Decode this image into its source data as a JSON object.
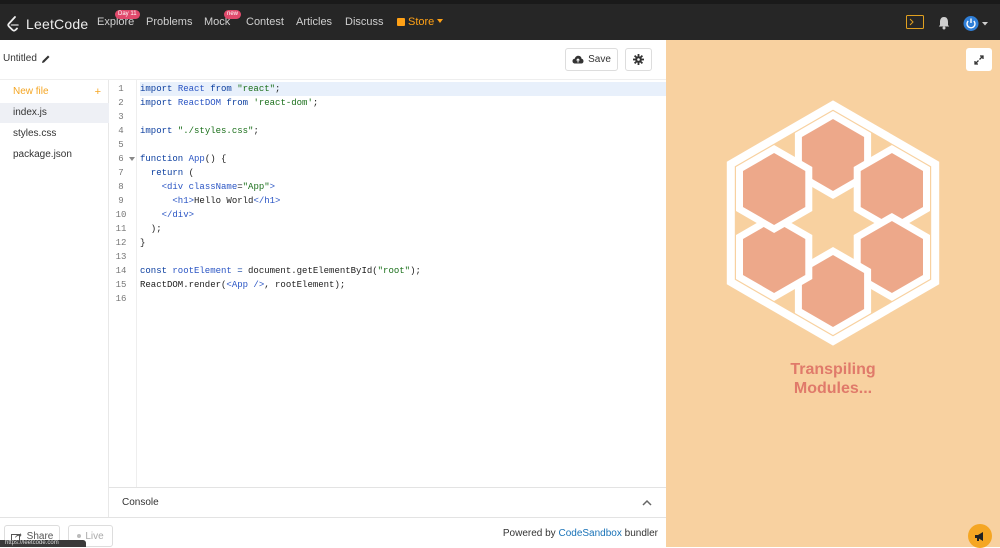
{
  "topbar": {
    "brand": "LeetCode",
    "nav": [
      {
        "label": "Explore",
        "badge": "Day 11"
      },
      {
        "label": "Problems"
      },
      {
        "label": "Mock",
        "badge": "new"
      },
      {
        "label": "Contest"
      },
      {
        "label": "Articles"
      },
      {
        "label": "Discuss"
      }
    ],
    "store_label": "Store",
    "icons": [
      "terminal-icon",
      "bell-icon",
      "power-avatar-icon"
    ]
  },
  "sandbox": {
    "title": "Untitled",
    "save_label": "Save",
    "files": [
      {
        "label": "New file"
      },
      {
        "label": "index.js",
        "active": true
      },
      {
        "label": "styles.css"
      },
      {
        "label": "package.json"
      }
    ],
    "new_file_plus": "+",
    "line_numbers": [
      "1",
      "2",
      "3",
      "4",
      "5",
      "6",
      "7",
      "8",
      "9",
      "10",
      "11",
      "12",
      "13",
      "14",
      "15",
      "16"
    ],
    "code": [
      [
        {
          "t": "import ",
          "c": "kw"
        },
        {
          "t": "React ",
          "c": "tag"
        },
        {
          "t": "from ",
          "c": "kw"
        },
        {
          "t": "\"react\"",
          "c": "str"
        },
        {
          "t": ";",
          "c": ""
        }
      ],
      [
        {
          "t": "import ",
          "c": "kw"
        },
        {
          "t": "ReactDOM ",
          "c": "tag"
        },
        {
          "t": "from ",
          "c": "kw"
        },
        {
          "t": "'react-dom'",
          "c": "str"
        },
        {
          "t": ";",
          "c": ""
        }
      ],
      [],
      [
        {
          "t": "import ",
          "c": "kw"
        },
        {
          "t": "\"./styles.css\"",
          "c": "str"
        },
        {
          "t": ";",
          "c": ""
        }
      ],
      [],
      [
        {
          "t": "function ",
          "c": "kw"
        },
        {
          "t": "App",
          "c": "tag"
        },
        {
          "t": "() {",
          "c": ""
        }
      ],
      [
        {
          "t": "  return ",
          "c": "kw"
        },
        {
          "t": "(",
          "c": ""
        }
      ],
      [
        {
          "t": "    ",
          "c": ""
        },
        {
          "t": "<div ",
          "c": "tag"
        },
        {
          "t": "className",
          "c": "tag"
        },
        {
          "t": "=",
          "c": ""
        },
        {
          "t": "\"App\"",
          "c": "str"
        },
        {
          "t": ">",
          "c": "tag"
        }
      ],
      [
        {
          "t": "      ",
          "c": ""
        },
        {
          "t": "<h1>",
          "c": "tag"
        },
        {
          "t": "Hello World",
          "c": ""
        },
        {
          "t": "</h1>",
          "c": "tag"
        }
      ],
      [
        {
          "t": "    ",
          "c": ""
        },
        {
          "t": "</div>",
          "c": "tag"
        }
      ],
      [
        {
          "t": "  );",
          "c": ""
        }
      ],
      [
        {
          "t": "}",
          "c": ""
        }
      ],
      [],
      [
        {
          "t": "const ",
          "c": "kw"
        },
        {
          "t": "rootElement ",
          "c": "tag"
        },
        {
          "t": "= ",
          "c": "kw"
        },
        {
          "t": "document.getElementById(",
          "c": ""
        },
        {
          "t": "\"root\"",
          "c": "str"
        },
        {
          "t": ");",
          "c": ""
        }
      ],
      [
        {
          "t": "ReactDOM.render(",
          "c": ""
        },
        {
          "t": "<App />",
          "c": "tag"
        },
        {
          "t": ", rootElement);",
          "c": ""
        }
      ],
      []
    ],
    "console_label": "Console",
    "share_label": "Share",
    "live_label": "Live",
    "powered_prefix": "Powered by ",
    "powered_link": "CodeSandbox",
    "powered_suffix": " bundler",
    "status_url": "https://leetcode.com"
  },
  "preview": {
    "status_text_line1": "Transpiling",
    "status_text_line2": "Modules...",
    "background_color": "#f8d1a0",
    "hex_color": "#eda88a"
  }
}
